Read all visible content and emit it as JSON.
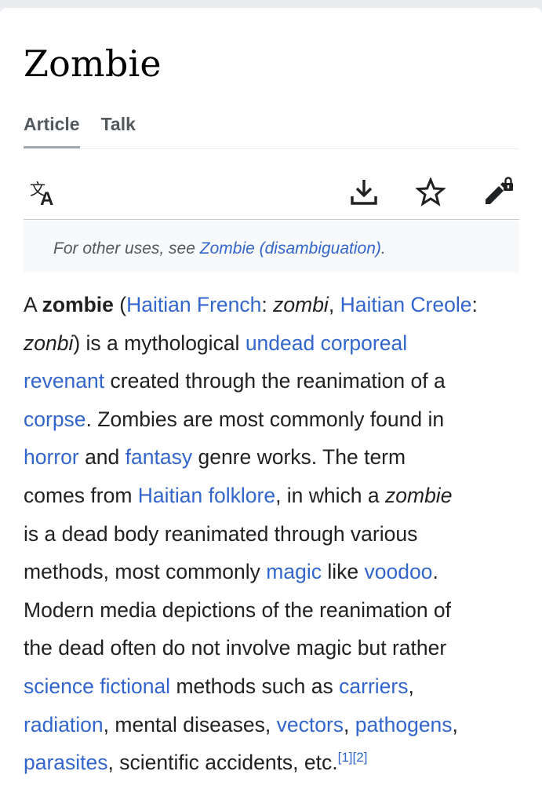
{
  "article": {
    "title": "Zombie"
  },
  "tabs": [
    {
      "label": "Article",
      "active": true
    },
    {
      "label": "Talk",
      "active": false
    }
  ],
  "toolbar": {
    "icons": [
      "language-icon",
      "download-icon",
      "star-icon",
      "edit-lock-icon"
    ]
  },
  "hatnote": {
    "prefix": "For other uses, see ",
    "link": "Zombie (disambiguation)",
    "suffix": "."
  },
  "paragraph": {
    "l1": {
      "a": "A ",
      "b": "zombie",
      "c": " (",
      "d": "Haitian French",
      "e": ": ",
      "f": "zombi",
      "g": ", ",
      "h": "Haitian Creole",
      "i": ":"
    },
    "l2": {
      "a": "zonbi",
      "b": ") is a mythological ",
      "c": "undead corporeal"
    },
    "l3": {
      "a": "revenant",
      "b": " created through the reanimation of a"
    },
    "l4": {
      "a": "corpse",
      "b": ". Zombies are most commonly found in"
    },
    "l5": {
      "a": "horror",
      "b": " and ",
      "c": "fantasy",
      "d": " genre works. The term"
    },
    "l6": {
      "a": "comes from ",
      "b": "Haitian folklore",
      "c": ", in which a ",
      "d": "zombie"
    },
    "l7": {
      "a": "is a dead body reanimated through various"
    },
    "l8": {
      "a": "methods, most commonly ",
      "b": "magic",
      "c": " like ",
      "d": "voodoo",
      "e": "."
    },
    "l9": {
      "a": "Modern media depictions of the reanimation of"
    },
    "l10": {
      "a": "the dead often do not involve magic but rather"
    },
    "l11": {
      "a": "science fictional",
      "b": " methods such as ",
      "c": "carriers",
      "d": ","
    },
    "l12": {
      "a": "radiation",
      "b": ", mental diseases, ",
      "c": "vectors",
      "d": ", ",
      "e": "pathogens",
      "f": ","
    },
    "l13": {
      "a": "parasites",
      "b": ", scientific accidents, etc.",
      "c": "[1]",
      "d": "[2]"
    }
  },
  "colors": {
    "link": "#3366cc",
    "text": "#202122",
    "muted": "#54595d",
    "hatnote_bg": "#f8f9fa",
    "page_bg": "#eaecf0"
  }
}
